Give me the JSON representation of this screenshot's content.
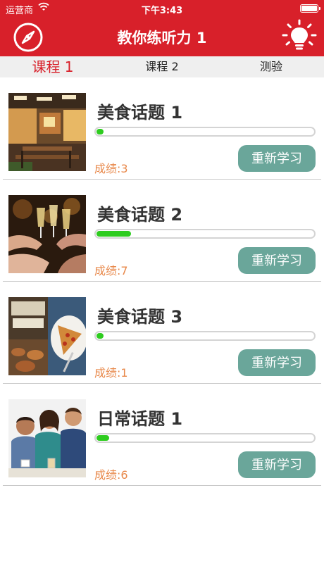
{
  "status_bar": {
    "carrier": "运营商",
    "time": "下午3:43"
  },
  "nav": {
    "title": "教你练听力 1",
    "left_icon": "compass-icon",
    "right_icon": "lightbulb-icon"
  },
  "tabs": [
    {
      "label": "课程 1",
      "active": true
    },
    {
      "label": "课程 2",
      "active": false
    },
    {
      "label": "测验",
      "active": false
    }
  ],
  "lessons": [
    {
      "title": "美食话题 1",
      "progress": 0.01,
      "score": "成绩:3",
      "button": "重新学习",
      "image": "restaurant-photo"
    },
    {
      "title": "美食话题 2",
      "progress": 0.16,
      "score": "成绩:7",
      "button": "重新学习",
      "image": "toast-photo"
    },
    {
      "title": "美食话题 3",
      "progress": 0.01,
      "score": "成绩:1",
      "button": "重新学习",
      "image": "pizza-photo"
    },
    {
      "title": "日常话题 1",
      "progress": 0.06,
      "score": "成绩:6",
      "button": "重新学习",
      "image": "friends-photo"
    }
  ],
  "colors": {
    "brand_red": "#d8202a",
    "progress_green": "#2ecc1f",
    "button_teal": "#6aa69a",
    "score_orange": "#e8884a"
  }
}
